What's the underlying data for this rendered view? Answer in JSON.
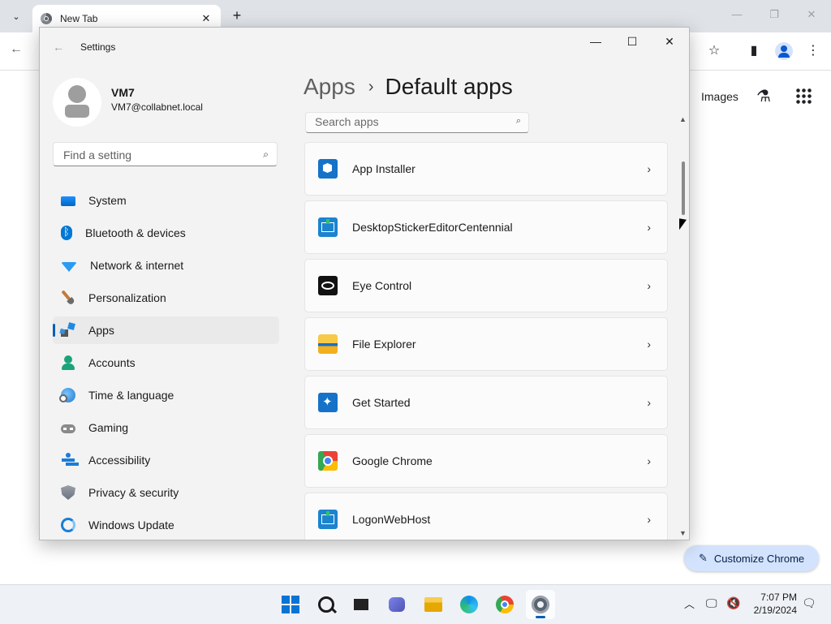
{
  "browser": {
    "tab_title": "New Tab",
    "tab_close": "✕",
    "new_tab": "+",
    "tab_search": "⌄",
    "window_controls": {
      "minimize": "—",
      "restore": "❐",
      "close": "✕"
    },
    "back": "←",
    "bookmark_star": "☆",
    "side_panel": "▮",
    "menu": "⋮",
    "images_link": "Images",
    "labs": "⚗",
    "customize_label": "Customize Chrome",
    "customize_pen": "✎"
  },
  "settings": {
    "title": "Settings",
    "back": "←",
    "window_controls": {
      "minimize": "—",
      "maximize": "☐",
      "close": "✕"
    },
    "user": {
      "name": "VM7",
      "email": "VM7@collabnet.local"
    },
    "find_placeholder": "Find a setting",
    "search_glyph": "⌕",
    "nav": [
      {
        "label": "System",
        "icon": "system-icon"
      },
      {
        "label": "Bluetooth & devices",
        "icon": "bluetooth-icon"
      },
      {
        "label": "Network & internet",
        "icon": "wifi-icon"
      },
      {
        "label": "Personalization",
        "icon": "brush-icon"
      },
      {
        "label": "Apps",
        "icon": "apps-icon",
        "selected": true
      },
      {
        "label": "Accounts",
        "icon": "accounts-icon"
      },
      {
        "label": "Time & language",
        "icon": "globe-clock-icon"
      },
      {
        "label": "Gaming",
        "icon": "gamepad-icon"
      },
      {
        "label": "Accessibility",
        "icon": "accessibility-icon"
      },
      {
        "label": "Privacy & security",
        "icon": "shield-icon"
      },
      {
        "label": "Windows Update",
        "icon": "update-icon"
      }
    ],
    "breadcrumb": {
      "parent": "Apps",
      "separator": "›",
      "current": "Default apps"
    },
    "search_apps_placeholder": "Search apps",
    "chevron": "›",
    "apps": [
      {
        "name": "App Installer",
        "icon": "app-installer-icon"
      },
      {
        "name": "DesktopStickerEditorCentennial",
        "icon": "sticker-editor-icon"
      },
      {
        "name": "Eye Control",
        "icon": "eye-control-icon"
      },
      {
        "name": "File Explorer",
        "icon": "file-explorer-icon"
      },
      {
        "name": "Get Started",
        "icon": "get-started-icon"
      },
      {
        "name": "Google Chrome",
        "icon": "chrome-icon"
      },
      {
        "name": "LogonWebHost",
        "icon": "logon-webhost-icon"
      }
    ],
    "scroll_up": "▲",
    "scroll_down": "▼"
  },
  "taskbar": {
    "tray_chevron": "︿",
    "tray_network": "🖵",
    "tray_volume": "🔇",
    "tray_notification": "🗨",
    "time": "7:07 PM",
    "date": "2/19/2024"
  },
  "colors": {
    "accent": "#005fb8",
    "customize_bg": "#d3e3fd",
    "settings_bg": "#f3f3f3"
  }
}
